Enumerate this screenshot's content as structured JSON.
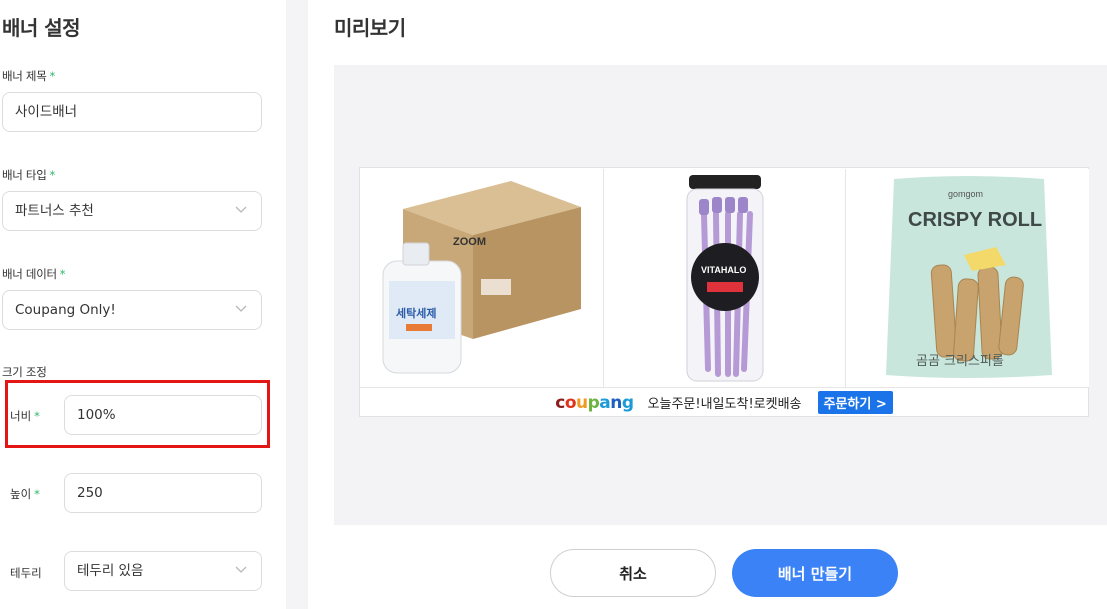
{
  "left_panel": {
    "title": "배너 설정",
    "banner_title": {
      "label": "배너 제목",
      "required_mark": "*",
      "value": "사이드배너"
    },
    "banner_type": {
      "label": "배너 타입",
      "required_mark": "*",
      "value": "파트너스 추천"
    },
    "banner_data": {
      "label": "배너 데이터",
      "required_mark": "*",
      "value": "Coupang Only!"
    },
    "size_section": {
      "label": "크기 조정"
    },
    "width": {
      "label": "너비",
      "required_mark": "*",
      "value": "100%"
    },
    "height": {
      "label": "높이",
      "required_mark": "*",
      "value": "250"
    },
    "border": {
      "label": "테두리",
      "value": "테두리 있음"
    }
  },
  "preview": {
    "title": "미리보기",
    "products": [
      {
        "name": "zoom-detergent",
        "box_text": "ZOOM",
        "bottle_text": "세탁세제"
      },
      {
        "name": "vitahalo-toothbrush",
        "brand": "VITAHALO"
      },
      {
        "name": "crispy-roll",
        "brand": "gomgom",
        "title": "CRISPY ROLL",
        "subtitle": "곰곰 크리스피롤"
      }
    ],
    "footer": {
      "logo": "coupang",
      "tagline": "오늘주문!내일도착!로켓배송",
      "order_button": "주문하기 >"
    }
  },
  "actions": {
    "cancel": "취소",
    "create": "배너 만들기"
  },
  "colors": {
    "accent": "#3b82f6",
    "required": "#2eb86b",
    "highlight": "#e41515"
  }
}
